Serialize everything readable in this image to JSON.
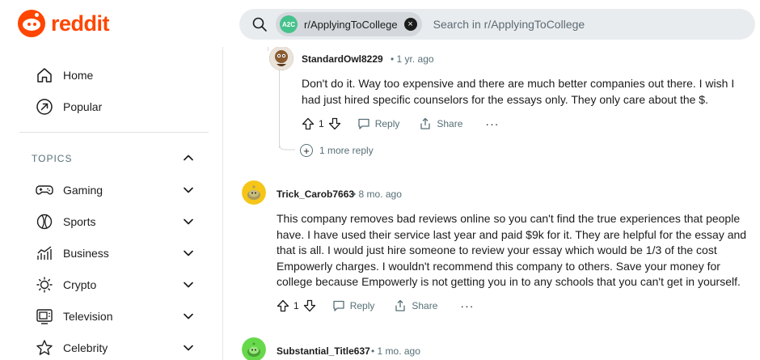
{
  "header": {
    "logo_text": "reddit",
    "search": {
      "chip_avatar": "A2C",
      "chip_label": "r/ApplyingToCollege",
      "placeholder": "Search in r/ApplyingToCollege"
    }
  },
  "sidebar": {
    "home": "Home",
    "popular": "Popular",
    "topics_header": "TOPICS",
    "topics": [
      {
        "label": "Gaming",
        "icon": "gamepad-icon"
      },
      {
        "label": "Sports",
        "icon": "ball-icon"
      },
      {
        "label": "Business",
        "icon": "chart-icon"
      },
      {
        "label": "Crypto",
        "icon": "crypto-icon"
      },
      {
        "label": "Television",
        "icon": "tv-icon"
      },
      {
        "label": "Celebrity",
        "icon": "star-icon"
      }
    ]
  },
  "comments": [
    {
      "username": "StandardOwl8229",
      "time": "• 1 yr. ago",
      "lines": [
        "Don't do it. Way too expensive and there are much better companies out there. I wish I",
        "had just hired specific counselors for the essays only. They only care about the $."
      ],
      "votes": "1",
      "reply": "Reply",
      "share": "Share",
      "more_replies": "1 more reply"
    },
    {
      "username": "Trick_Carob7663",
      "time": "• 8 mo. ago",
      "lines": [
        "This company removes bad reviews online so you can't find the true experiences that people",
        "have. I have used their service last year and paid $9k for it. They are helpful for the essay and",
        "that is all. I would just hire someone to review your essay which would be 1/3 of the cost",
        "Empowerly charges. I wouldn't recommend this company to others. Save your money for",
        "college because Empowerly is not getting you in to any schools that you can't get in yourself."
      ],
      "votes": "1",
      "reply": "Reply",
      "share": "Share"
    },
    {
      "username": "Substantial_Title637",
      "time": "• 1 mo. ago"
    }
  ],
  "colors": {
    "brand": "#ff4500",
    "avatar_yellow": "#f5c518",
    "avatar_green": "#66d94a"
  }
}
